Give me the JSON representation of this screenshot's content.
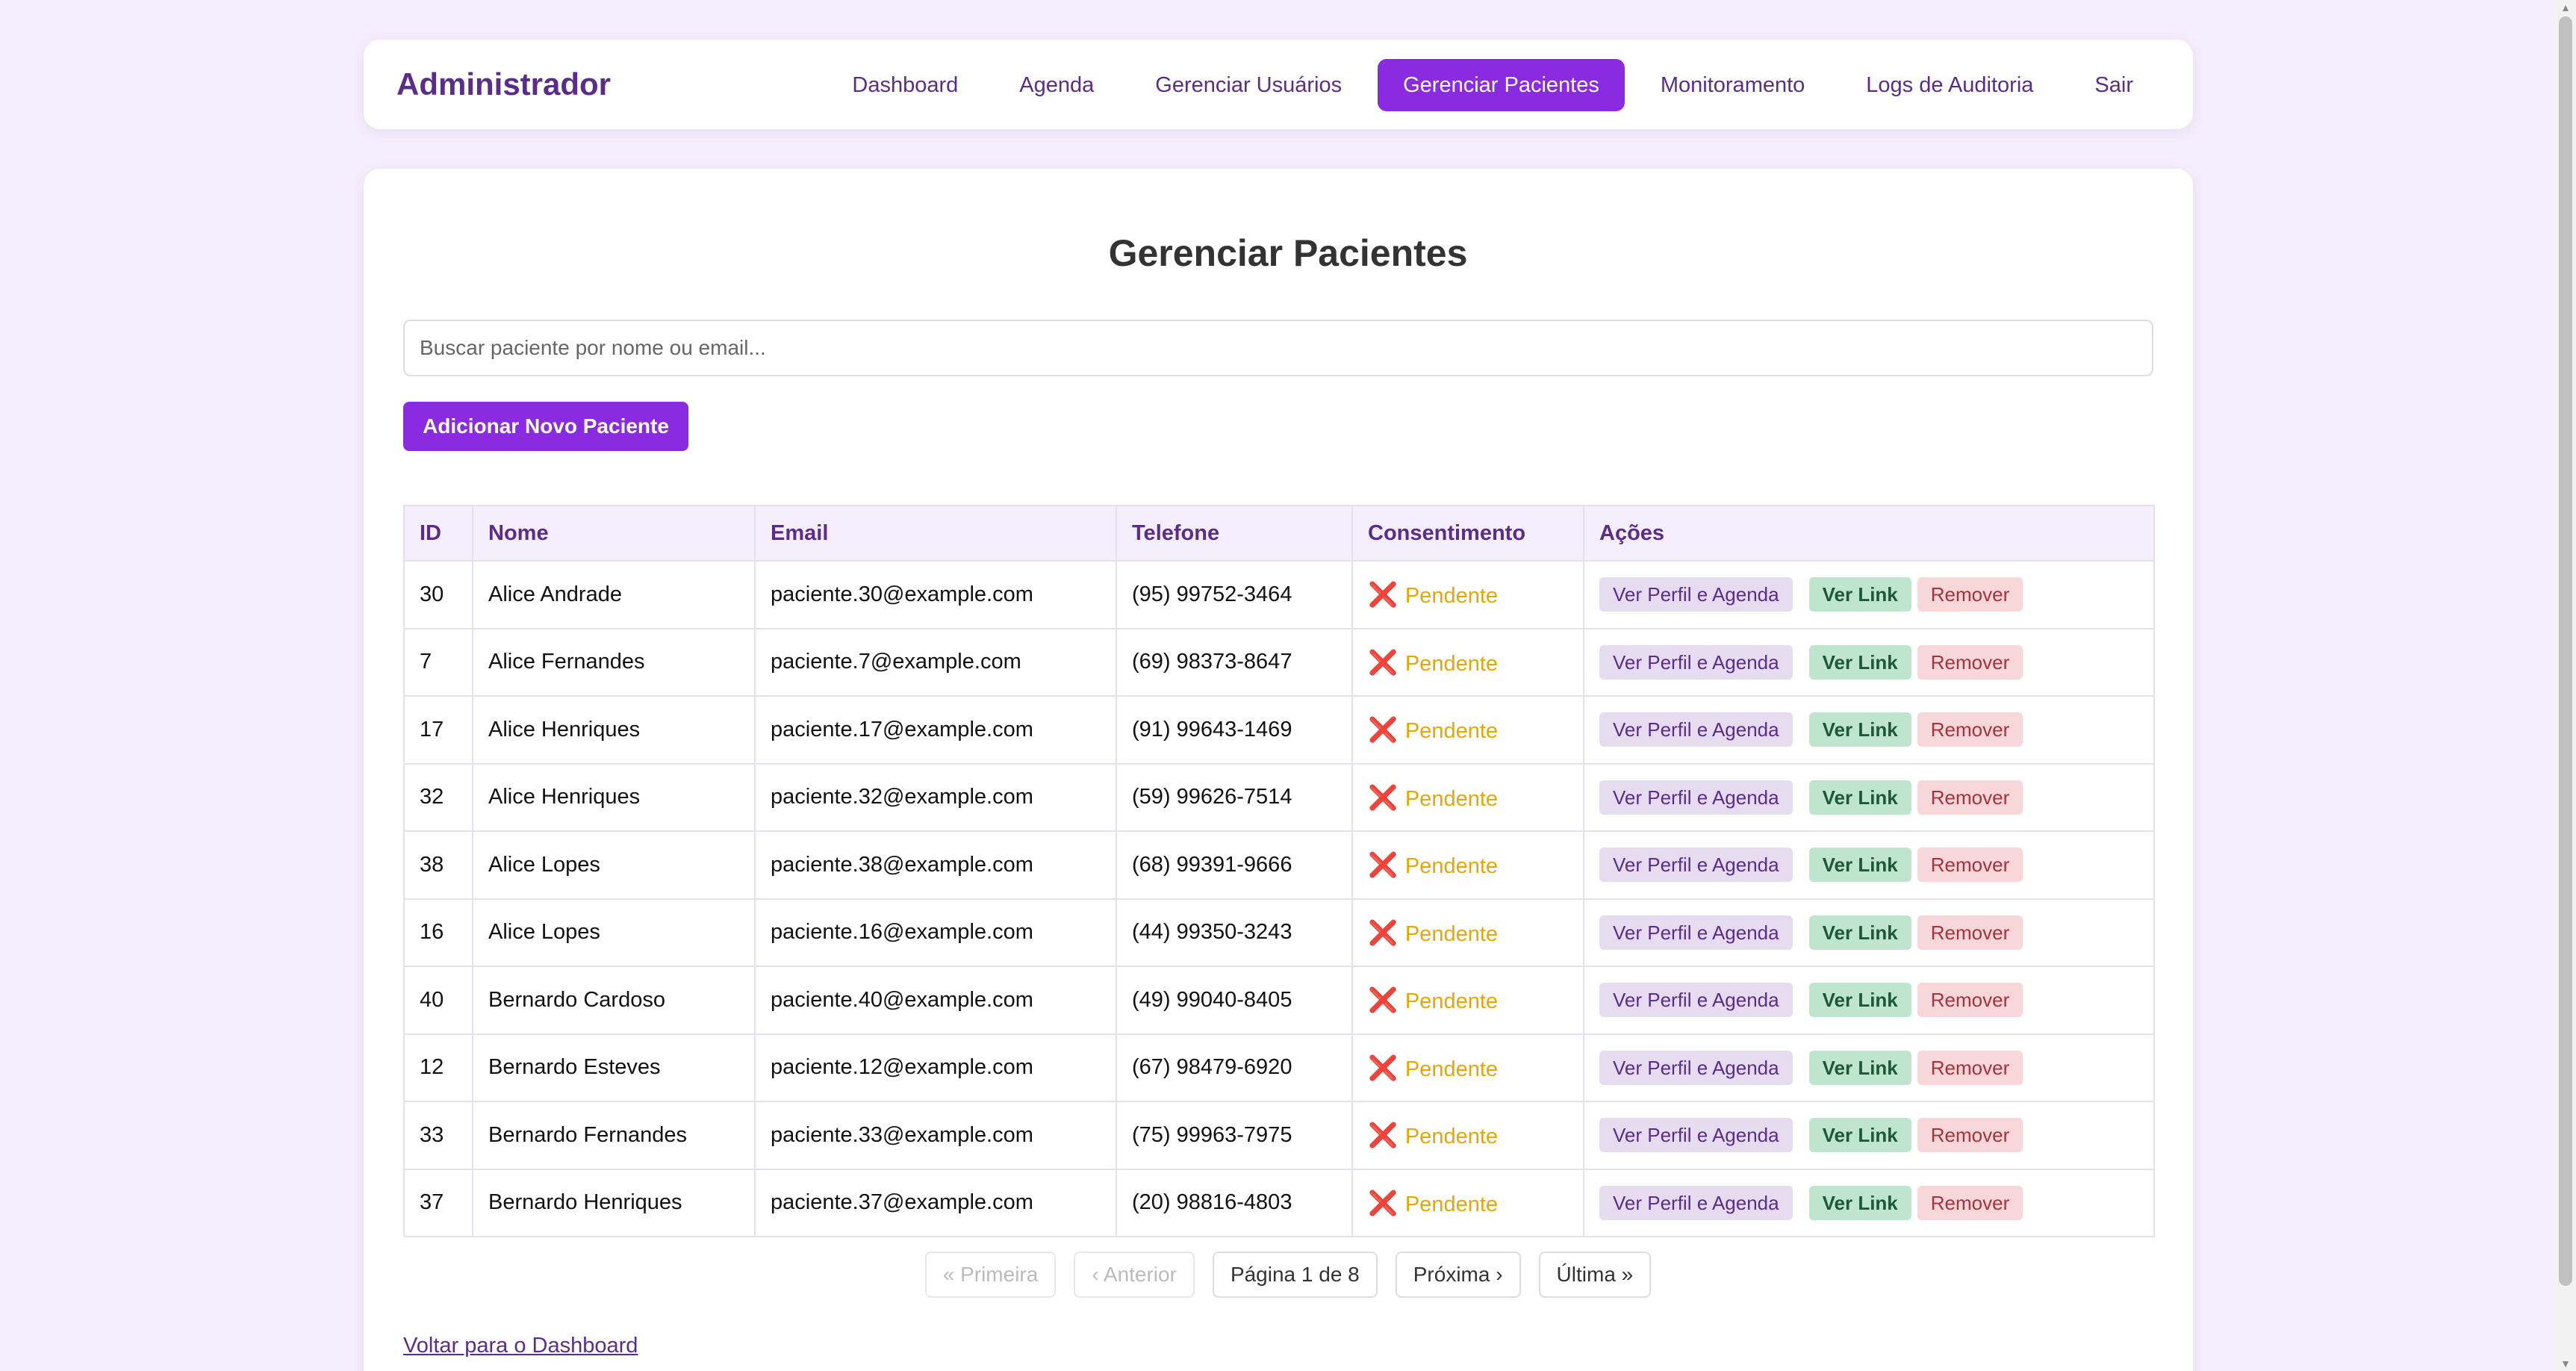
{
  "header": {
    "brand": "Administrador",
    "nav": [
      {
        "label": "Dashboard",
        "active": false
      },
      {
        "label": "Agenda",
        "active": false
      },
      {
        "label": "Gerenciar Usuários",
        "active": false
      },
      {
        "label": "Gerenciar Pacientes",
        "active": true
      },
      {
        "label": "Monitoramento",
        "active": false
      },
      {
        "label": "Logs de Auditoria",
        "active": false
      },
      {
        "label": "Sair",
        "active": false
      }
    ]
  },
  "main": {
    "title": "Gerenciar Pacientes",
    "search": {
      "placeholder": "Buscar paciente por nome ou email...",
      "value": ""
    },
    "add_button": "Adicionar Novo Paciente",
    "table": {
      "columns": [
        "ID",
        "Nome",
        "Email",
        "Telefone",
        "Consentimento",
        "Ações"
      ],
      "rows": [
        {
          "id": "30",
          "nome": "Alice Andrade",
          "email": "paciente.30@example.com",
          "telefone": "(95) 99752-3464",
          "consentimento": "Pendente"
        },
        {
          "id": "7",
          "nome": "Alice Fernandes",
          "email": "paciente.7@example.com",
          "telefone": "(69) 98373-8647",
          "consentimento": "Pendente"
        },
        {
          "id": "17",
          "nome": "Alice Henriques",
          "email": "paciente.17@example.com",
          "telefone": "(91) 99643-1469",
          "consentimento": "Pendente"
        },
        {
          "id": "32",
          "nome": "Alice Henriques",
          "email": "paciente.32@example.com",
          "telefone": "(59) 99626-7514",
          "consentimento": "Pendente"
        },
        {
          "id": "38",
          "nome": "Alice Lopes",
          "email": "paciente.38@example.com",
          "telefone": "(68) 99391-9666",
          "consentimento": "Pendente"
        },
        {
          "id": "16",
          "nome": "Alice Lopes",
          "email": "paciente.16@example.com",
          "telefone": "(44) 99350-3243",
          "consentimento": "Pendente"
        },
        {
          "id": "40",
          "nome": "Bernardo Cardoso",
          "email": "paciente.40@example.com",
          "telefone": "(49) 99040-8405",
          "consentimento": "Pendente"
        },
        {
          "id": "12",
          "nome": "Bernardo Esteves",
          "email": "paciente.12@example.com",
          "telefone": "(67) 98479-6920",
          "consentimento": "Pendente"
        },
        {
          "id": "33",
          "nome": "Bernardo Fernandes",
          "email": "paciente.33@example.com",
          "telefone": "(75) 99963-7975",
          "consentimento": "Pendente"
        },
        {
          "id": "37",
          "nome": "Bernardo Henriques",
          "email": "paciente.37@example.com",
          "telefone": "(20) 98816-4803",
          "consentimento": "Pendente"
        }
      ],
      "actions": {
        "profile": "Ver Perfil e Agenda",
        "link": "Ver Link",
        "remove": "Remover"
      },
      "status_icon": "x-mark-icon",
      "status_glyph": "❌"
    },
    "pagination": {
      "first": "« Primeira",
      "prev": "‹ Anterior",
      "info": "Página 1 de 8",
      "next": "Próxima ›",
      "last": "Última »"
    },
    "back_link": "Voltar para o Dashboard"
  },
  "colors": {
    "accent": "#8a2be2",
    "brand_text": "#5a2d8c",
    "background": "#f5eefc",
    "pending": "#e6a800",
    "link_green_bg": "#bfe5cf",
    "remove_red_bg": "#f8d7da"
  }
}
